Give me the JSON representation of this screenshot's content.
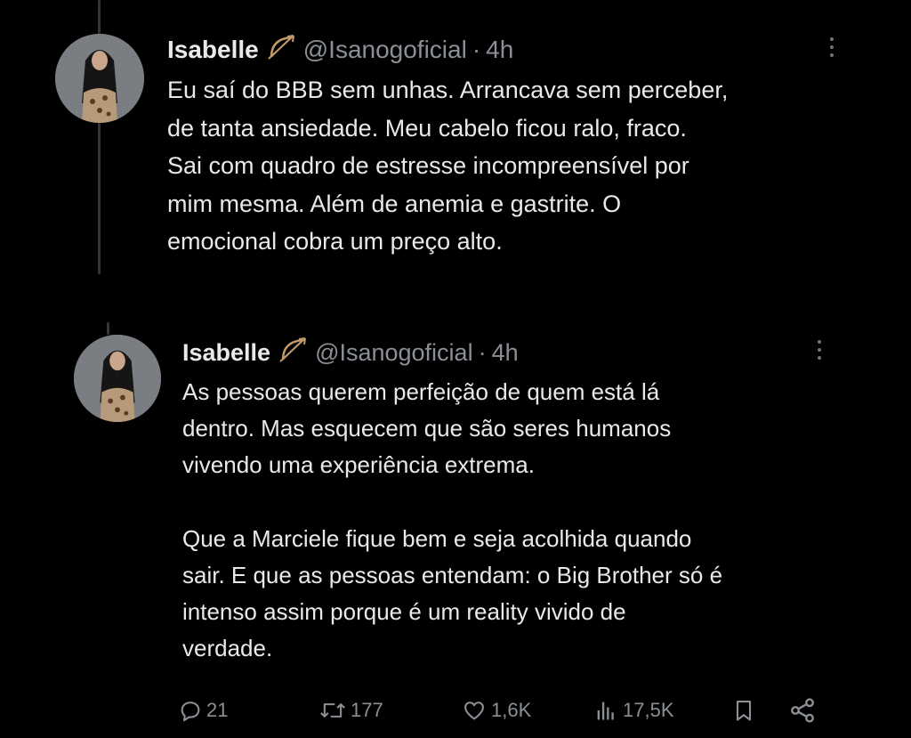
{
  "tweets": [
    {
      "display_name": "Isabelle",
      "handle": "@Isanogoficial",
      "separator": "·",
      "time": "4h",
      "badge_icon": "bow-and-arrow-icon",
      "text": "Eu saí do BBB sem unhas. Arrancava sem perceber,\nde tanta ansiedade. Meu cabelo ficou ralo, fraco.\nSai com quadro de estresse incompreensível por\nmim mesma. Além de anemia e gastrite. O\nemocional cobra um preço alto."
    },
    {
      "display_name": "Isabelle",
      "handle": "@Isanogoficial",
      "separator": "·",
      "time": "4h",
      "badge_icon": "bow-and-arrow-icon",
      "text": "As pessoas querem perfeição de quem está lá\ndentro. Mas esquecem que são seres humanos\nvivendo uma experiência extrema.\n\nQue a Marciele fique bem e seja acolhida quando\nsair. E que as pessoas entendam: o Big Brother só é\nintenso assim porque é um reality vivido de\nverdade."
    }
  ],
  "actions": {
    "replies": "21",
    "reposts": "177",
    "likes": "1,6K",
    "views": "17,5K"
  },
  "colors": {
    "background": "#000000",
    "text": "#e7e9ea",
    "secondary": "#8b9096",
    "thread_line": "#333639",
    "badge": "#c49a6c"
  }
}
